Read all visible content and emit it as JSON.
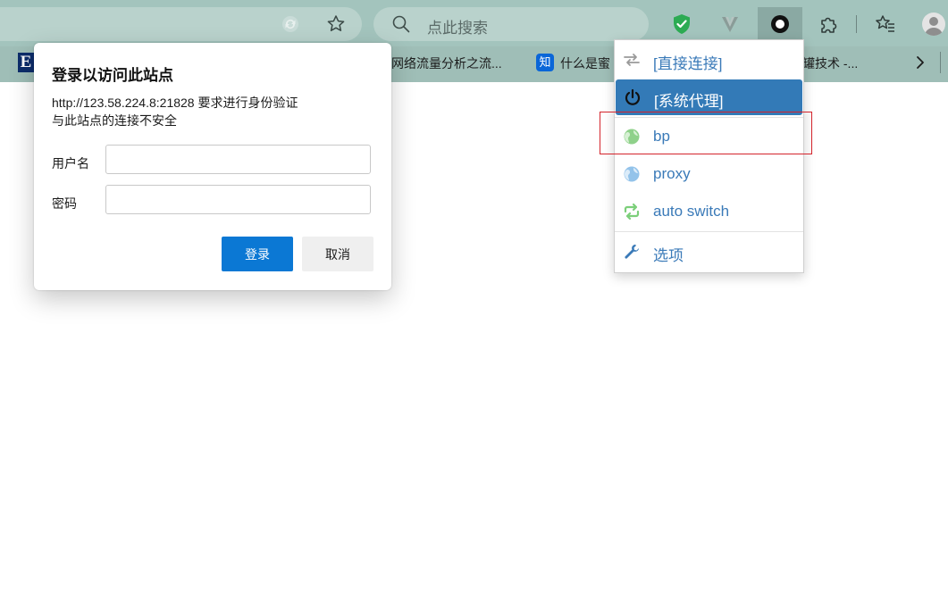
{
  "toolbar": {
    "search_placeholder": "点此搜索",
    "icons": [
      "refresh-icon",
      "star-icon",
      "search-icon",
      "shield-check-icon",
      "v-extension-icon",
      "proxy-switch-icon",
      "puzzle-extension-icon",
      "favorites-icon",
      "avatar"
    ]
  },
  "bookmarks": {
    "items": [
      {
        "icon": "E-logo",
        "label": ""
      },
      {
        "icon": "",
        "label": "网络流量分析之流..."
      },
      {
        "icon": "zhi-logo",
        "logo_text": "知",
        "label": "什么是蜜"
      },
      {
        "icon": "",
        "label": "罐技术 -..."
      }
    ]
  },
  "dialog": {
    "title": "登录以访问此站点",
    "message_line1": "http://123.58.224.8:21828 要求进行身份验证",
    "message_line2": "与此站点的连接不安全",
    "username_label": "用户名",
    "username_value": "",
    "password_label": "密码",
    "password_value": "",
    "login_button": "登录",
    "cancel_button": "取消"
  },
  "proxy_menu": {
    "items": [
      {
        "label": "[直接连接]",
        "icon": "arrows-swap-icon",
        "active": false
      },
      {
        "label": "[系统代理]",
        "icon": "power-icon",
        "active": true
      },
      {
        "label": "bp",
        "icon": "globe-icon",
        "active": false
      },
      {
        "label": "proxy",
        "icon": "globe-icon",
        "active": false
      },
      {
        "label": "auto switch",
        "icon": "auto-switch-icon",
        "active": false
      },
      {
        "label": "选项",
        "icon": "wrench-icon",
        "active": false
      }
    ]
  },
  "colors": {
    "toolbar_bg": "#a3c4bd",
    "primary_button": "#0b78d4",
    "menu_active": "#337ab7",
    "menu_text": "#3a7ab8",
    "highlight_box": "#d4242c"
  }
}
